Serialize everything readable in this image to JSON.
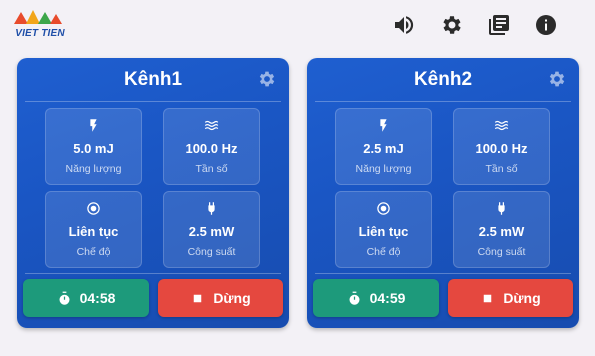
{
  "app": {
    "logo_text": "VIET TIEN"
  },
  "toolbar": {
    "icons": [
      "volume-icon",
      "settings-gear-icon",
      "library-books-icon",
      "info-icon"
    ]
  },
  "colors": {
    "background": "#f3f1f6",
    "card": "#1a56c4",
    "timer_button": "#1d9a7b",
    "stop_button": "#e5483f"
  },
  "channels": [
    {
      "title": "Kênh1",
      "energy": {
        "value": "5.0 mJ",
        "label": "Năng lượng"
      },
      "frequency": {
        "value": "100.0 Hz",
        "label": "Tần số"
      },
      "mode": {
        "value": "Liên tục",
        "label": "Chế độ"
      },
      "power": {
        "value": "2.5 mW",
        "label": "Công suất"
      },
      "timer": "04:58",
      "stop_label": "Dừng"
    },
    {
      "title": "Kênh2",
      "energy": {
        "value": "2.5 mJ",
        "label": "Năng lượng"
      },
      "frequency": {
        "value": "100.0 Hz",
        "label": "Tần số"
      },
      "mode": {
        "value": "Liên tục",
        "label": "Chế độ"
      },
      "power": {
        "value": "2.5 mW",
        "label": "Công suất"
      },
      "timer": "04:59",
      "stop_label": "Dừng"
    }
  ]
}
